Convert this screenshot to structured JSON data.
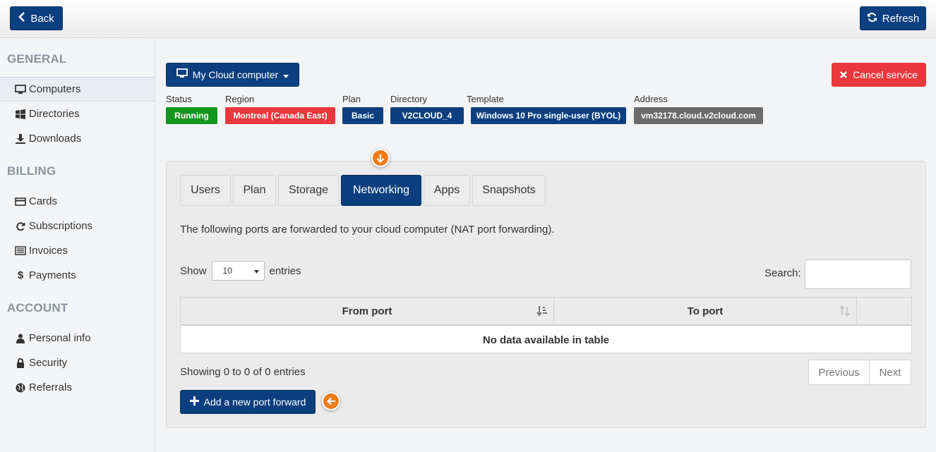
{
  "topbar": {
    "back_label": "Back",
    "refresh_label": "Refresh"
  },
  "sidebar": {
    "sections": [
      {
        "title": "GENERAL",
        "items": [
          {
            "label": "Computers",
            "icon": "monitor-icon",
            "active": true
          },
          {
            "label": "Directories",
            "icon": "windows-icon"
          },
          {
            "label": "Downloads",
            "icon": "download-icon"
          }
        ]
      },
      {
        "title": "BILLING",
        "items": [
          {
            "label": "Cards",
            "icon": "credit-card-icon"
          },
          {
            "label": "Subscriptions",
            "icon": "refresh-icon"
          },
          {
            "label": "Invoices",
            "icon": "list-icon"
          },
          {
            "label": "Payments",
            "icon": "dollar-icon"
          }
        ]
      },
      {
        "title": "ACCOUNT",
        "items": [
          {
            "label": "Personal info",
            "icon": "user-icon"
          },
          {
            "label": "Security",
            "icon": "lock-icon"
          },
          {
            "label": "Referrals",
            "icon": "globe-icon"
          }
        ]
      }
    ]
  },
  "computer_menu": {
    "label": "My Cloud computer"
  },
  "cancel_label": "Cancel service",
  "info": {
    "status": {
      "label": "Status",
      "value": "Running"
    },
    "region": {
      "label": "Region",
      "value": "Montreal (Canada East)"
    },
    "plan": {
      "label": "Plan",
      "value": "Basic"
    },
    "directory": {
      "label": "Directory",
      "value": "V2CLOUD_4"
    },
    "template": {
      "label": "Template",
      "value": "Windows 10 Pro single-user (BYOL)"
    },
    "address": {
      "label": "Address",
      "value": "vm32178.cloud.v2cloud.com"
    }
  },
  "tabs": [
    {
      "label": "Users"
    },
    {
      "label": "Plan"
    },
    {
      "label": "Storage"
    },
    {
      "label": "Networking",
      "active": true
    },
    {
      "label": "Apps"
    },
    {
      "label": "Snapshots"
    }
  ],
  "networking": {
    "description": "The following ports are forwarded to your cloud computer (NAT port forwarding).",
    "show_label": "Show",
    "entries_value": "10",
    "entries_label": "entries",
    "search_label": "Search:",
    "search_value": "",
    "columns": [
      "From port",
      "To port",
      ""
    ],
    "empty_message": "No data available in table",
    "info": "Showing 0 to 0 of 0 entries",
    "previous_label": "Previous",
    "next_label": "Next",
    "add_label": "Add a new port forward"
  },
  "colors": {
    "navy": "#0b3f7f",
    "running": "#12961f",
    "region": "#e8383d",
    "address": "#6b6b6b",
    "cancel": "#e8383d",
    "marker": "#f07c1a"
  }
}
